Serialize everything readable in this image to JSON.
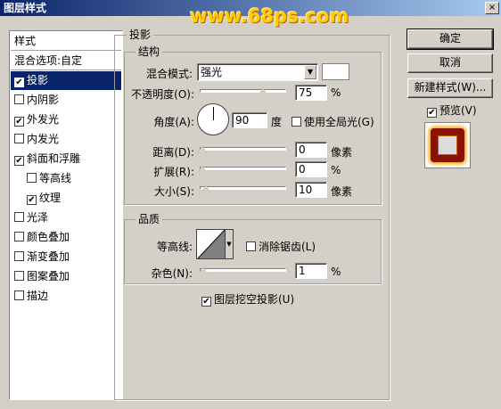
{
  "window": {
    "title": "图层样式",
    "close": "×"
  },
  "watermark": "www.68ps.com",
  "styles": {
    "header": "样式",
    "items": [
      {
        "label": "混合选项:自定",
        "checkbox": false,
        "checked": false,
        "selected": false,
        "indent": false
      },
      {
        "label": "投影",
        "checkbox": true,
        "checked": true,
        "selected": true,
        "indent": false
      },
      {
        "label": "内阴影",
        "checkbox": true,
        "checked": false,
        "selected": false,
        "indent": false
      },
      {
        "label": "外发光",
        "checkbox": true,
        "checked": true,
        "selected": false,
        "indent": false
      },
      {
        "label": "内发光",
        "checkbox": true,
        "checked": false,
        "selected": false,
        "indent": false
      },
      {
        "label": "斜面和浮雕",
        "checkbox": true,
        "checked": true,
        "selected": false,
        "indent": false
      },
      {
        "label": "等高线",
        "checkbox": true,
        "checked": false,
        "selected": false,
        "indent": true
      },
      {
        "label": "纹理",
        "checkbox": true,
        "checked": true,
        "selected": false,
        "indent": true
      },
      {
        "label": "光泽",
        "checkbox": true,
        "checked": false,
        "selected": false,
        "indent": false
      },
      {
        "label": "颜色叠加",
        "checkbox": true,
        "checked": false,
        "selected": false,
        "indent": false
      },
      {
        "label": "渐变叠加",
        "checkbox": true,
        "checked": false,
        "selected": false,
        "indent": false
      },
      {
        "label": "图案叠加",
        "checkbox": true,
        "checked": false,
        "selected": false,
        "indent": false
      },
      {
        "label": "描边",
        "checkbox": true,
        "checked": false,
        "selected": false,
        "indent": false
      }
    ]
  },
  "panel": {
    "title": "投影",
    "structure": {
      "title": "结构",
      "blend_mode_label": "混合模式:",
      "blend_mode_value": "强光",
      "blend_color": "#ffffff",
      "opacity_label": "不透明度(O):",
      "opacity_value": "75",
      "opacity_unit": "%",
      "opacity_level": 0.75,
      "angle_label": "角度(A):",
      "angle_value": "90",
      "angle_unit": "度",
      "global_light_label": "使用全局光(G)",
      "global_light_checked": false,
      "distance_label": "距离(D):",
      "distance_value": "0",
      "distance_unit": "像素",
      "distance_level": 0,
      "spread_label": "扩展(R):",
      "spread_value": "0",
      "spread_unit": "%",
      "spread_level": 0,
      "size_label": "大小(S):",
      "size_value": "10",
      "size_unit": "像素",
      "size_level": 0.04
    },
    "quality": {
      "title": "品质",
      "contour_label": "等高线:",
      "anti_alias_label": "消除锯齿(L)",
      "anti_alias_checked": false,
      "noise_label": "杂色(N):",
      "noise_value": "1",
      "noise_unit": "%",
      "noise_level": 0.01
    },
    "knockout_label": "图层挖空投影(U)",
    "knockout_checked": true
  },
  "buttons": {
    "ok": "确定",
    "cancel": "取消",
    "new_style": "新建样式(W)...",
    "preview_label": "预览(V)",
    "preview_checked": true
  },
  "check_mark": "✔"
}
